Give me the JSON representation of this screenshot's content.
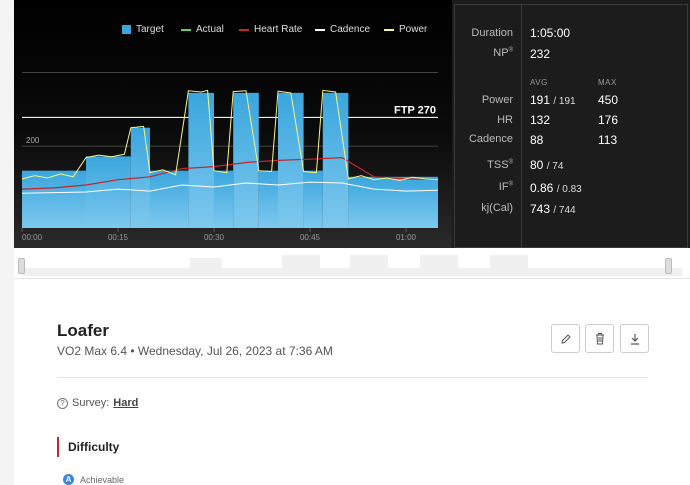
{
  "legend": [
    {
      "label": "Target",
      "color": "#3aa6dd",
      "kind": "box"
    },
    {
      "label": "Actual",
      "color": "#5ed36a",
      "kind": "line"
    },
    {
      "label": "Heart Rate",
      "color": "#c0272d",
      "kind": "line"
    },
    {
      "label": "Cadence",
      "color": "#ffffff",
      "kind": "line"
    },
    {
      "label": "Power",
      "color": "#f5f58a",
      "kind": "line"
    }
  ],
  "chart_data": {
    "type": "area",
    "x_ticks": [
      "00:00",
      "00:15",
      "00:30",
      "00:45",
      "01:00"
    ],
    "x_range_min": [
      0,
      65
    ],
    "y_labels": [
      "200"
    ],
    "ftp_label": "FTP 270",
    "ftp_value": 270,
    "y_reference": 200,
    "target_segments": [
      {
        "start": 0,
        "end": 10,
        "power": 140
      },
      {
        "start": 10,
        "end": 17,
        "power": 175
      },
      {
        "start": 17,
        "end": 20,
        "power": 245
      },
      {
        "start": 20,
        "end": 26,
        "power": 140
      },
      {
        "start": 26,
        "end": 30,
        "power": 330
      },
      {
        "start": 30,
        "end": 33,
        "power": 140
      },
      {
        "start": 33,
        "end": 37,
        "power": 330
      },
      {
        "start": 37,
        "end": 40,
        "power": 140
      },
      {
        "start": 40,
        "end": 44,
        "power": 330
      },
      {
        "start": 44,
        "end": 47,
        "power": 140
      },
      {
        "start": 47,
        "end": 51,
        "power": 330
      },
      {
        "start": 51,
        "end": 65,
        "power": 125
      }
    ],
    "power_series": [
      [
        0,
        120
      ],
      [
        2,
        128
      ],
      [
        4,
        122
      ],
      [
        6,
        132
      ],
      [
        8,
        125
      ],
      [
        10,
        172
      ],
      [
        12,
        178
      ],
      [
        14,
        174
      ],
      [
        16,
        180
      ],
      [
        17,
        245
      ],
      [
        19,
        248
      ],
      [
        20,
        135
      ],
      [
        22,
        142
      ],
      [
        24,
        130
      ],
      [
        26,
        335
      ],
      [
        28,
        332
      ],
      [
        29,
        336
      ],
      [
        30,
        140
      ],
      [
        32,
        135
      ],
      [
        33,
        333
      ],
      [
        35,
        335
      ],
      [
        37,
        140
      ],
      [
        39,
        138
      ],
      [
        40,
        334
      ],
      [
        42,
        330
      ],
      [
        44,
        138
      ],
      [
        46,
        135
      ],
      [
        47,
        336
      ],
      [
        49,
        332
      ],
      [
        51,
        120
      ],
      [
        53,
        128
      ],
      [
        55,
        118
      ],
      [
        57,
        122
      ],
      [
        59,
        116
      ],
      [
        61,
        124
      ],
      [
        63,
        120
      ],
      [
        65,
        118
      ]
    ],
    "heart_rate_series": [
      [
        0,
        95
      ],
      [
        5,
        98
      ],
      [
        10,
        105
      ],
      [
        15,
        118
      ],
      [
        20,
        125
      ],
      [
        25,
        145
      ],
      [
        30,
        150
      ],
      [
        35,
        160
      ],
      [
        40,
        165
      ],
      [
        45,
        168
      ],
      [
        50,
        172
      ],
      [
        55,
        125
      ],
      [
        60,
        120
      ],
      [
        65,
        118
      ]
    ],
    "cadence_series": [
      [
        0,
        85
      ],
      [
        10,
        88
      ],
      [
        15,
        95
      ],
      [
        20,
        90
      ],
      [
        25,
        105
      ],
      [
        30,
        100
      ],
      [
        35,
        110
      ],
      [
        40,
        105
      ],
      [
        45,
        112
      ],
      [
        50,
        110
      ],
      [
        55,
        95
      ],
      [
        60,
        90
      ],
      [
        65,
        92
      ]
    ]
  },
  "stats": {
    "duration_label": "Duration",
    "duration_value": "1:05:00",
    "np_label": "NP",
    "np_value": "232",
    "avg_header": "AVG",
    "max_header": "MAX",
    "power_label": "Power",
    "power_avg": "191",
    "power_avg_target": "/ 191",
    "power_max": "450",
    "hr_label": "HR",
    "hr_avg": "132",
    "hr_max": "176",
    "cadence_label": "Cadence",
    "cadence_avg": "88",
    "cadence_max": "113",
    "tss_label": "TSS",
    "tss_value": "80",
    "tss_target": "/ 74",
    "if_label": "IF",
    "if_value": "0.86",
    "if_target": "/ 0.83",
    "kj_label": "kj(Cal)",
    "kj_value": "743",
    "kj_target": "/ 744"
  },
  "workout": {
    "title": "Loafer",
    "subtitle": "VO2 Max 6.4 • Wednesday, Jul 26, 2023 at 7:36 AM",
    "survey_label": "Survey:",
    "survey_value": "Hard",
    "difficulty_title": "Difficulty",
    "achievable_label": "Achievable",
    "achievable_badge": "A"
  }
}
